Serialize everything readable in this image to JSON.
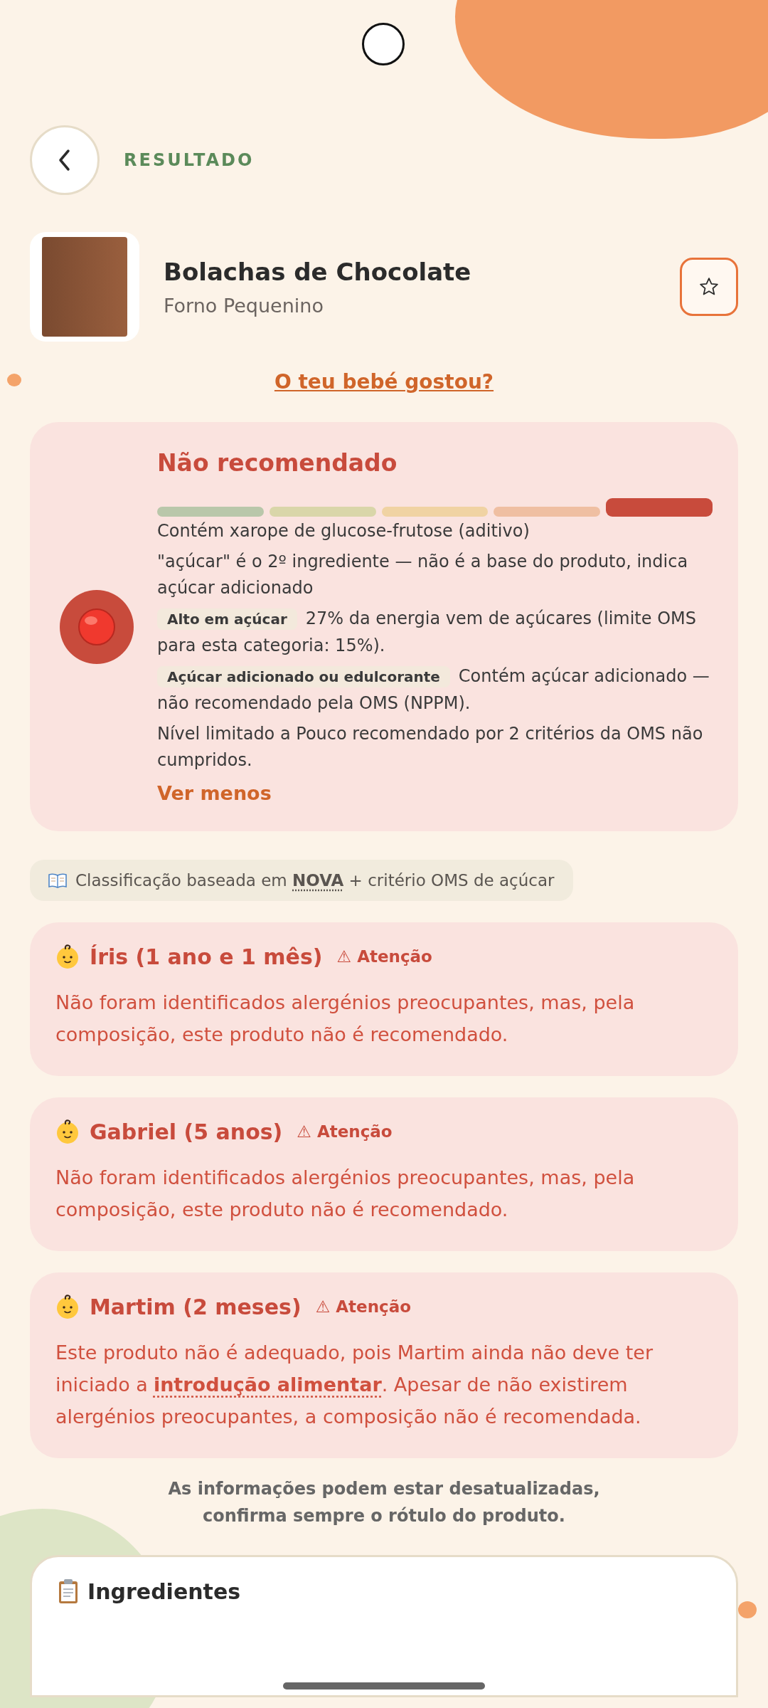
{
  "header": {
    "title": "RESULTADO"
  },
  "product": {
    "name": "Bolachas de Chocolate",
    "brand": "Forno Pequenino",
    "favorite": false
  },
  "feedback_link": "O teu bebé gostou?",
  "verdict": {
    "title": "Não recomendado",
    "color": "#c84b3c",
    "scale": [
      {
        "color": "#b9c7aa",
        "selected": false
      },
      {
        "color": "#d9d6a9",
        "selected": false
      },
      {
        "color": "#f0d3a3",
        "selected": false
      },
      {
        "color": "#efbfa2",
        "selected": false
      },
      {
        "color": "#c84b3c",
        "selected": true
      }
    ],
    "criteria": [
      {
        "kind": "plain",
        "text": "Contém xarope de glucose-frutose (aditivo)"
      },
      {
        "kind": "plain",
        "text": "\"açúcar\" é o 2º ingrediente — não é a base do produto, indica açúcar adicionado"
      },
      {
        "kind": "tagged",
        "tag": "Alto em açúcar",
        "text": "27% da energia vem de açúcares (limite OMS para esta categoria: 15%)."
      },
      {
        "kind": "tagged",
        "tag": "Açúcar adicionado ou edulcorante",
        "text": "Contém açúcar adicionado — não recomendado pela OMS (NPPM)."
      },
      {
        "kind": "plain",
        "text": "Nível limitado a Pouco recomendado por 2 critérios da OMS não cumpridos."
      }
    ],
    "toggle": "Ver menos"
  },
  "source_note": {
    "before": "Classificação baseada em",
    "link": "NOVA",
    "after": "+ critério OMS de açúcar"
  },
  "children": [
    {
      "name": "Íris (1 ano e 1 mês)",
      "status": "⚠ Atenção",
      "message": {
        "before": "Não foram identificados alergénios preocupantes, mas, pela composição, este produto não é recomendado."
      }
    },
    {
      "name": "Gabriel (5 anos)",
      "status": "⚠ Atenção",
      "message": {
        "before": "Não foram identificados alergénios preocupantes, mas, pela composição, este produto não é recomendado."
      }
    },
    {
      "name": "Martim (2 meses)",
      "status": "⚠ Atenção",
      "message": {
        "before": "Este produto não é adequado, pois Martim ainda não deve ter iniciado a",
        "link": "introdução alimentar",
        "after": ". Apesar de não existirem alergénios preocupantes, a composição não é recomendada."
      }
    }
  ],
  "disclaimer": "As informações podem estar desatualizadas, confirma sempre o rótulo do produto.",
  "ingredients": {
    "title": "Ingredientes"
  }
}
